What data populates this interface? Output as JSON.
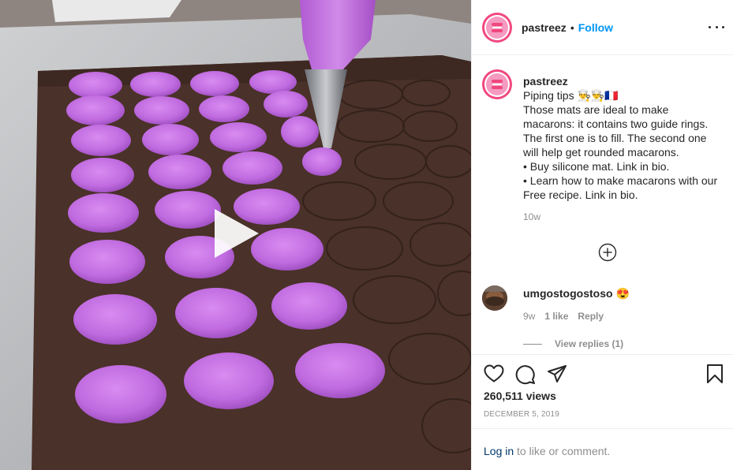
{
  "post": {
    "username": "pastreez",
    "follow_label": "Follow",
    "separator": "•",
    "caption_lines": [
      "Piping tips 👨‍🍳👨‍🍳🇫🇷",
      "Those mats are ideal to make",
      "macarons: it contains two guide rings.",
      "The first one is to fill. The second one",
      "will help get rounded macarons.",
      "• Buy silicone mat. Link in bio.",
      "• Learn how to make macarons with our",
      "Free recipe. Link in bio."
    ],
    "caption_age": "10w",
    "views": "260,511 views",
    "date": "DECEMBER 5, 2019"
  },
  "comment": {
    "username": "umgostogostoso",
    "emoji": "😍",
    "age": "9w",
    "likes": "1 like",
    "reply_label": "Reply",
    "view_replies": "View replies (1)"
  },
  "login_prompt": {
    "link": "Log in",
    "rest": " to like or comment."
  },
  "icons": {
    "play": "play-icon",
    "more": "more-options-icon",
    "load_more": "load-more-comments-icon",
    "like": "heart-icon",
    "comment": "comment-icon",
    "share": "share-icon",
    "save": "bookmark-icon"
  },
  "colors": {
    "follow": "#0095f6",
    "brand": "#f1477f",
    "macaron": "#c06be0",
    "mat": "#4a3129"
  }
}
